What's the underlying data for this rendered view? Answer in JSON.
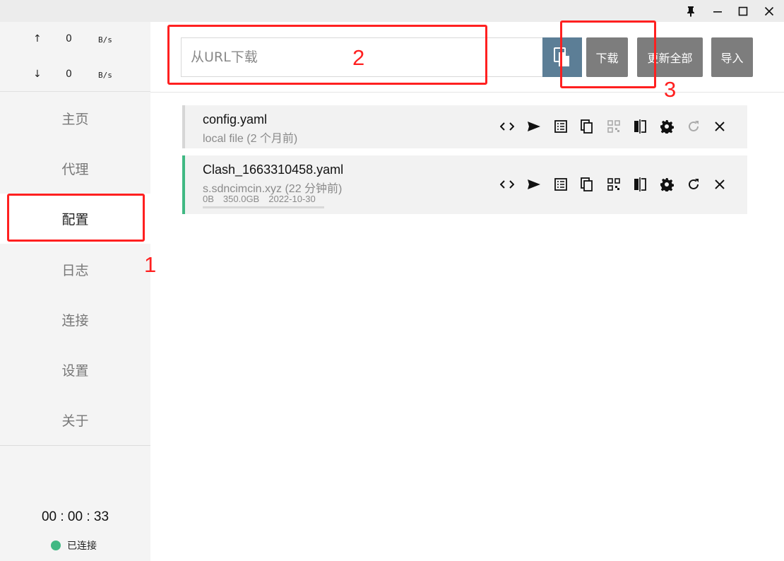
{
  "window": {
    "controls": [
      "pin-icon",
      "minimize-icon",
      "maximize-icon",
      "close-icon"
    ]
  },
  "traffic": {
    "up_arrow": "↑",
    "up_value": "0",
    "up_unit": "B/s",
    "down_arrow": "↓",
    "down_value": "0",
    "down_unit": "B/s"
  },
  "sidebar": {
    "items": [
      {
        "label": "主页"
      },
      {
        "label": "代理"
      },
      {
        "label": "配置"
      },
      {
        "label": "日志"
      },
      {
        "label": "连接"
      },
      {
        "label": "设置"
      },
      {
        "label": "关于"
      }
    ],
    "active_index": 2,
    "timer": "00 : 00 : 33",
    "status_label": "已连接",
    "status_color": "#40b883"
  },
  "toolbar": {
    "url_placeholder": "从URL下载",
    "url_value": "",
    "paste_icon": "paste-icon",
    "download_label": "下载",
    "update_all_label": "更新全部",
    "import_label": "导入",
    "accent": "#5c7e96",
    "button_color": "#7d7d7d"
  },
  "profiles": [
    {
      "name": "config.yaml",
      "subtitle": "local file (2 个月前)",
      "bar_color": "#d6d6d6",
      "active": false,
      "refresh_enabled": false
    },
    {
      "name": "Clash_1663310458.yaml",
      "subtitle": "s.sdncimcin.xyz (22 分钟前)",
      "usage": "0B",
      "total": "350.0GB",
      "expire": "2022-10-30",
      "usage_fraction": 0,
      "bar_color": "#40b883",
      "active": true,
      "refresh_enabled": true
    }
  ],
  "profile_actions": [
    "code-icon",
    "send-icon",
    "list-icon",
    "copy-icon",
    "qrcode-icon",
    "compare-icon",
    "gear-icon",
    "refresh-icon",
    "close-icon"
  ],
  "annotations": {
    "color": "#ff2020",
    "labels": [
      "1",
      "2",
      "3"
    ]
  }
}
